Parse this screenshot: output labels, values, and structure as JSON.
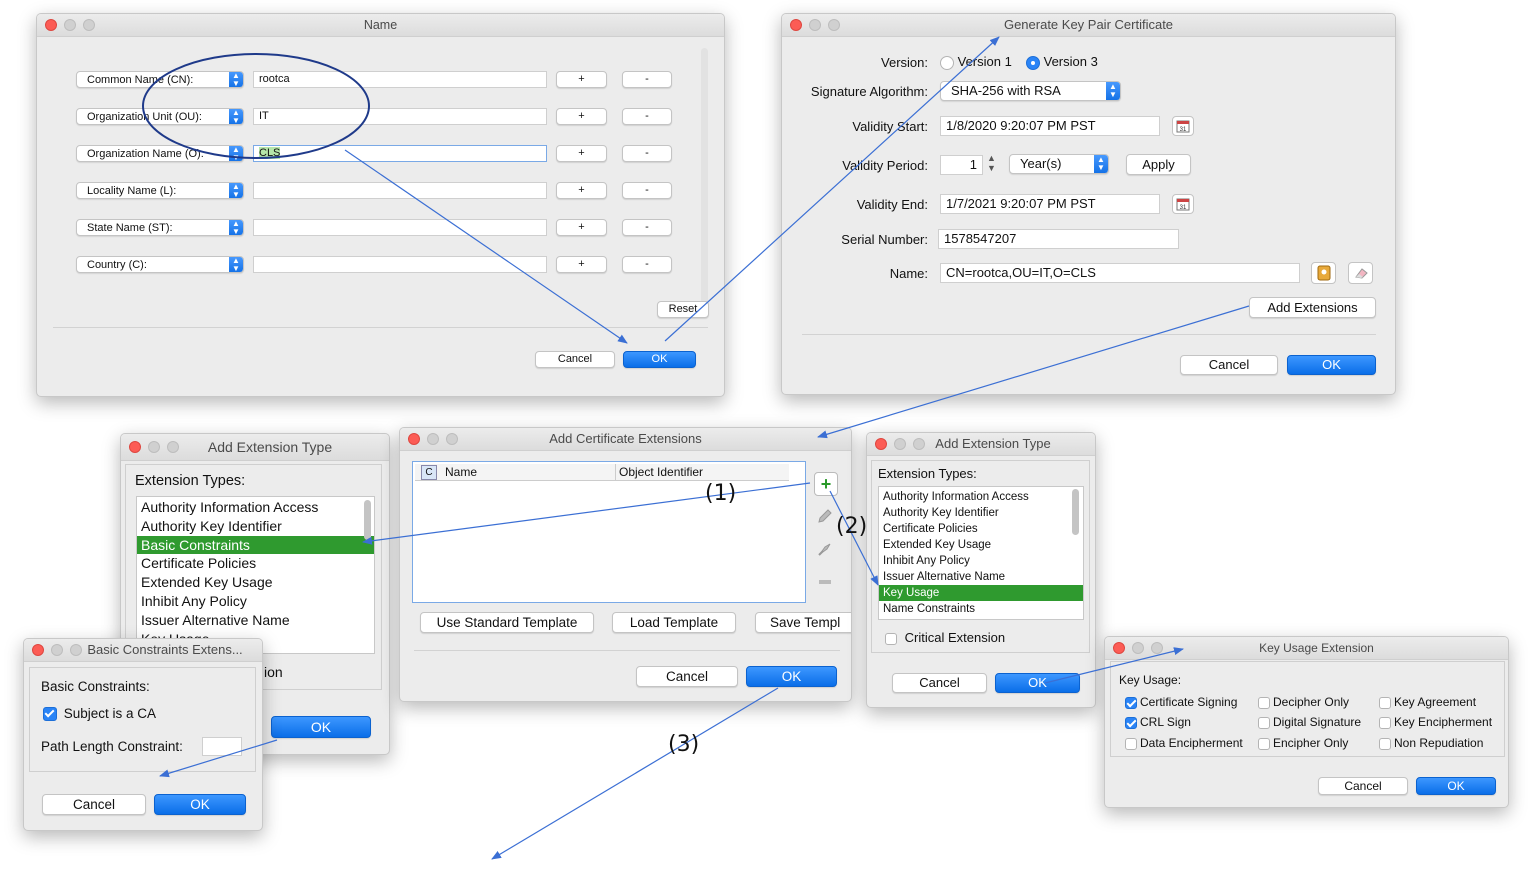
{
  "name_dialog": {
    "title": "Name",
    "rows": [
      {
        "combo": "Common Name (CN):",
        "value": "rootca"
      },
      {
        "combo": "Organization Unit (OU):",
        "value": "IT"
      },
      {
        "combo": "Organization Name (O):",
        "value": "CLS"
      },
      {
        "combo": "Locality Name (L):",
        "value": ""
      },
      {
        "combo": "State Name (ST):",
        "value": ""
      },
      {
        "combo": "Country (C):",
        "value": ""
      }
    ],
    "plus": "+",
    "minus": "-",
    "reset": "Reset",
    "cancel": "Cancel",
    "ok": "OK"
  },
  "gen_dialog": {
    "title": "Generate Key Pair Certificate",
    "version_label": "Version:",
    "version1": "Version 1",
    "version3": "Version 3",
    "sigalg_label": "Signature Algorithm:",
    "sigalg": "SHA-256 with RSA",
    "vstart_label": "Validity Start:",
    "vstart": "1/8/2020 9:20:07 PM PST",
    "vperiod_label": "Validity Period:",
    "vperiod": "1",
    "vunit": "Year(s)",
    "apply": "Apply",
    "vend_label": "Validity End:",
    "vend": "1/7/2021 9:20:07 PM PST",
    "serial_label": "Serial Number:",
    "serial": "1578547207",
    "name_label": "Name:",
    "name": "CN=rootca,OU=IT,O=CLS",
    "add_ext": "Add Extensions",
    "cancel": "Cancel",
    "ok": "OK"
  },
  "ext_type_left": {
    "title": "Add Extension Type",
    "label": "Extension Types:",
    "items": [
      "Authority Information Access",
      "Authority Key Identifier",
      "Basic Constraints",
      "Certificate Policies",
      "Extended Key Usage",
      "Inhibit Any Policy",
      "Issuer Alternative Name",
      "Key Usage"
    ],
    "selected": "Basic Constraints",
    "partial_text": "ion",
    "ok": "OK"
  },
  "cert_ext": {
    "title": "Add Certificate Extensions",
    "col_c": "C",
    "col_name": "Name",
    "col_oid": "Object Identifier",
    "use_std": "Use Standard Template",
    "load": "Load Template",
    "save": "Save Templ",
    "cancel": "Cancel",
    "ok": "OK"
  },
  "ext_type_right": {
    "title": "Add Extension Type",
    "label": "Extension Types:",
    "items": [
      "Authority Information Access",
      "Authority Key Identifier",
      "Certificate Policies",
      "Extended Key Usage",
      "Inhibit Any Policy",
      "Issuer Alternative Name",
      "Key Usage",
      "Name Constraints"
    ],
    "selected": "Key Usage",
    "critical": "Critical Extension",
    "cancel": "Cancel",
    "ok": "OK"
  },
  "basic_dialog": {
    "title": "Basic Constraints Extens...",
    "label": "Basic Constraints:",
    "subject_ca": "Subject is a CA",
    "path_len": "Path Length Constraint:",
    "cancel": "Cancel",
    "ok": "OK"
  },
  "keyusage_dialog": {
    "title": "Key Usage Extension",
    "label": "Key Usage:",
    "items": [
      {
        "label": "Certificate Signing",
        "checked": true
      },
      {
        "label": "Decipher Only",
        "checked": false
      },
      {
        "label": "Key Agreement",
        "checked": false
      },
      {
        "label": "CRL Sign",
        "checked": true
      },
      {
        "label": "Digital Signature",
        "checked": false
      },
      {
        "label": "Key Encipherment",
        "checked": false
      },
      {
        "label": "Data Encipherment",
        "checked": false
      },
      {
        "label": "Encipher Only",
        "checked": false
      },
      {
        "label": "Non Repudiation",
        "checked": false
      }
    ],
    "cancel": "Cancel",
    "ok": "OK"
  },
  "annotations": {
    "step1": "(1)",
    "step2": "(2)",
    "step3": "(3)",
    "arrow_color": "#3b6fd4",
    "circle_color": "#1f3a8a"
  }
}
